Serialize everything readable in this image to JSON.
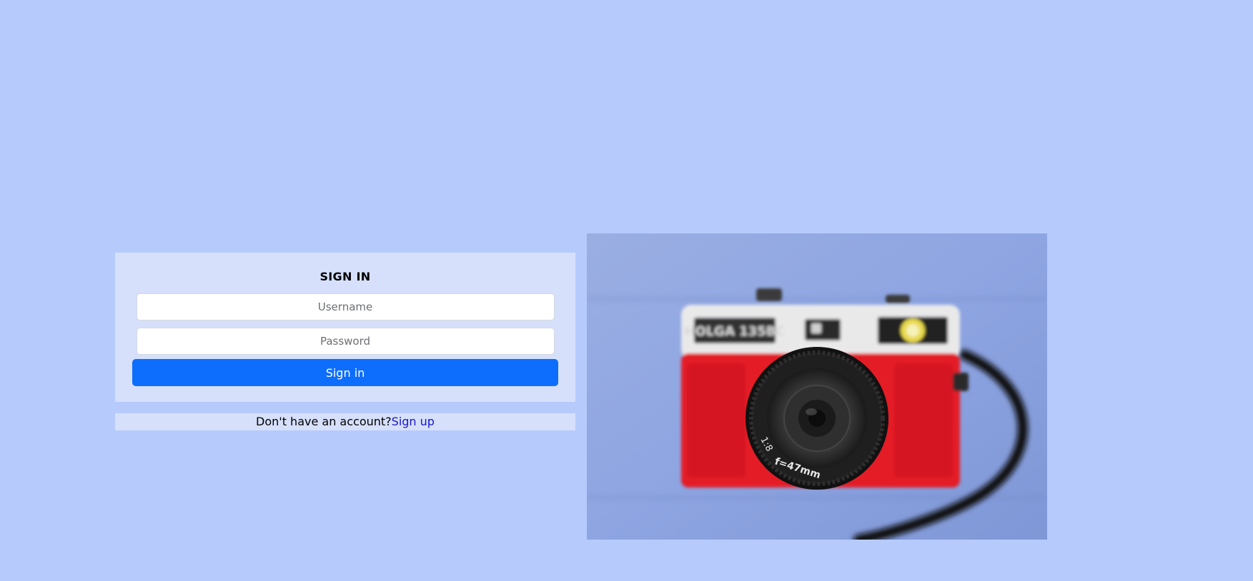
{
  "signin": {
    "title": "SIGN IN",
    "username_placeholder": "Username",
    "password_placeholder": "Password",
    "button_label": "Sign in"
  },
  "signup": {
    "prompt": "Don't have an account?",
    "link_label": "Sign up"
  },
  "photo": {
    "subject": "camera-photo",
    "brand_text": "HOLGA 135BC",
    "lens_aperture": "1:8",
    "lens_focal": "f=47mm"
  },
  "colors": {
    "page_background": "#b6cafc",
    "card_background": "#d6e0fb",
    "primary_button": "#0d6efd",
    "link": "#1a16c9"
  }
}
